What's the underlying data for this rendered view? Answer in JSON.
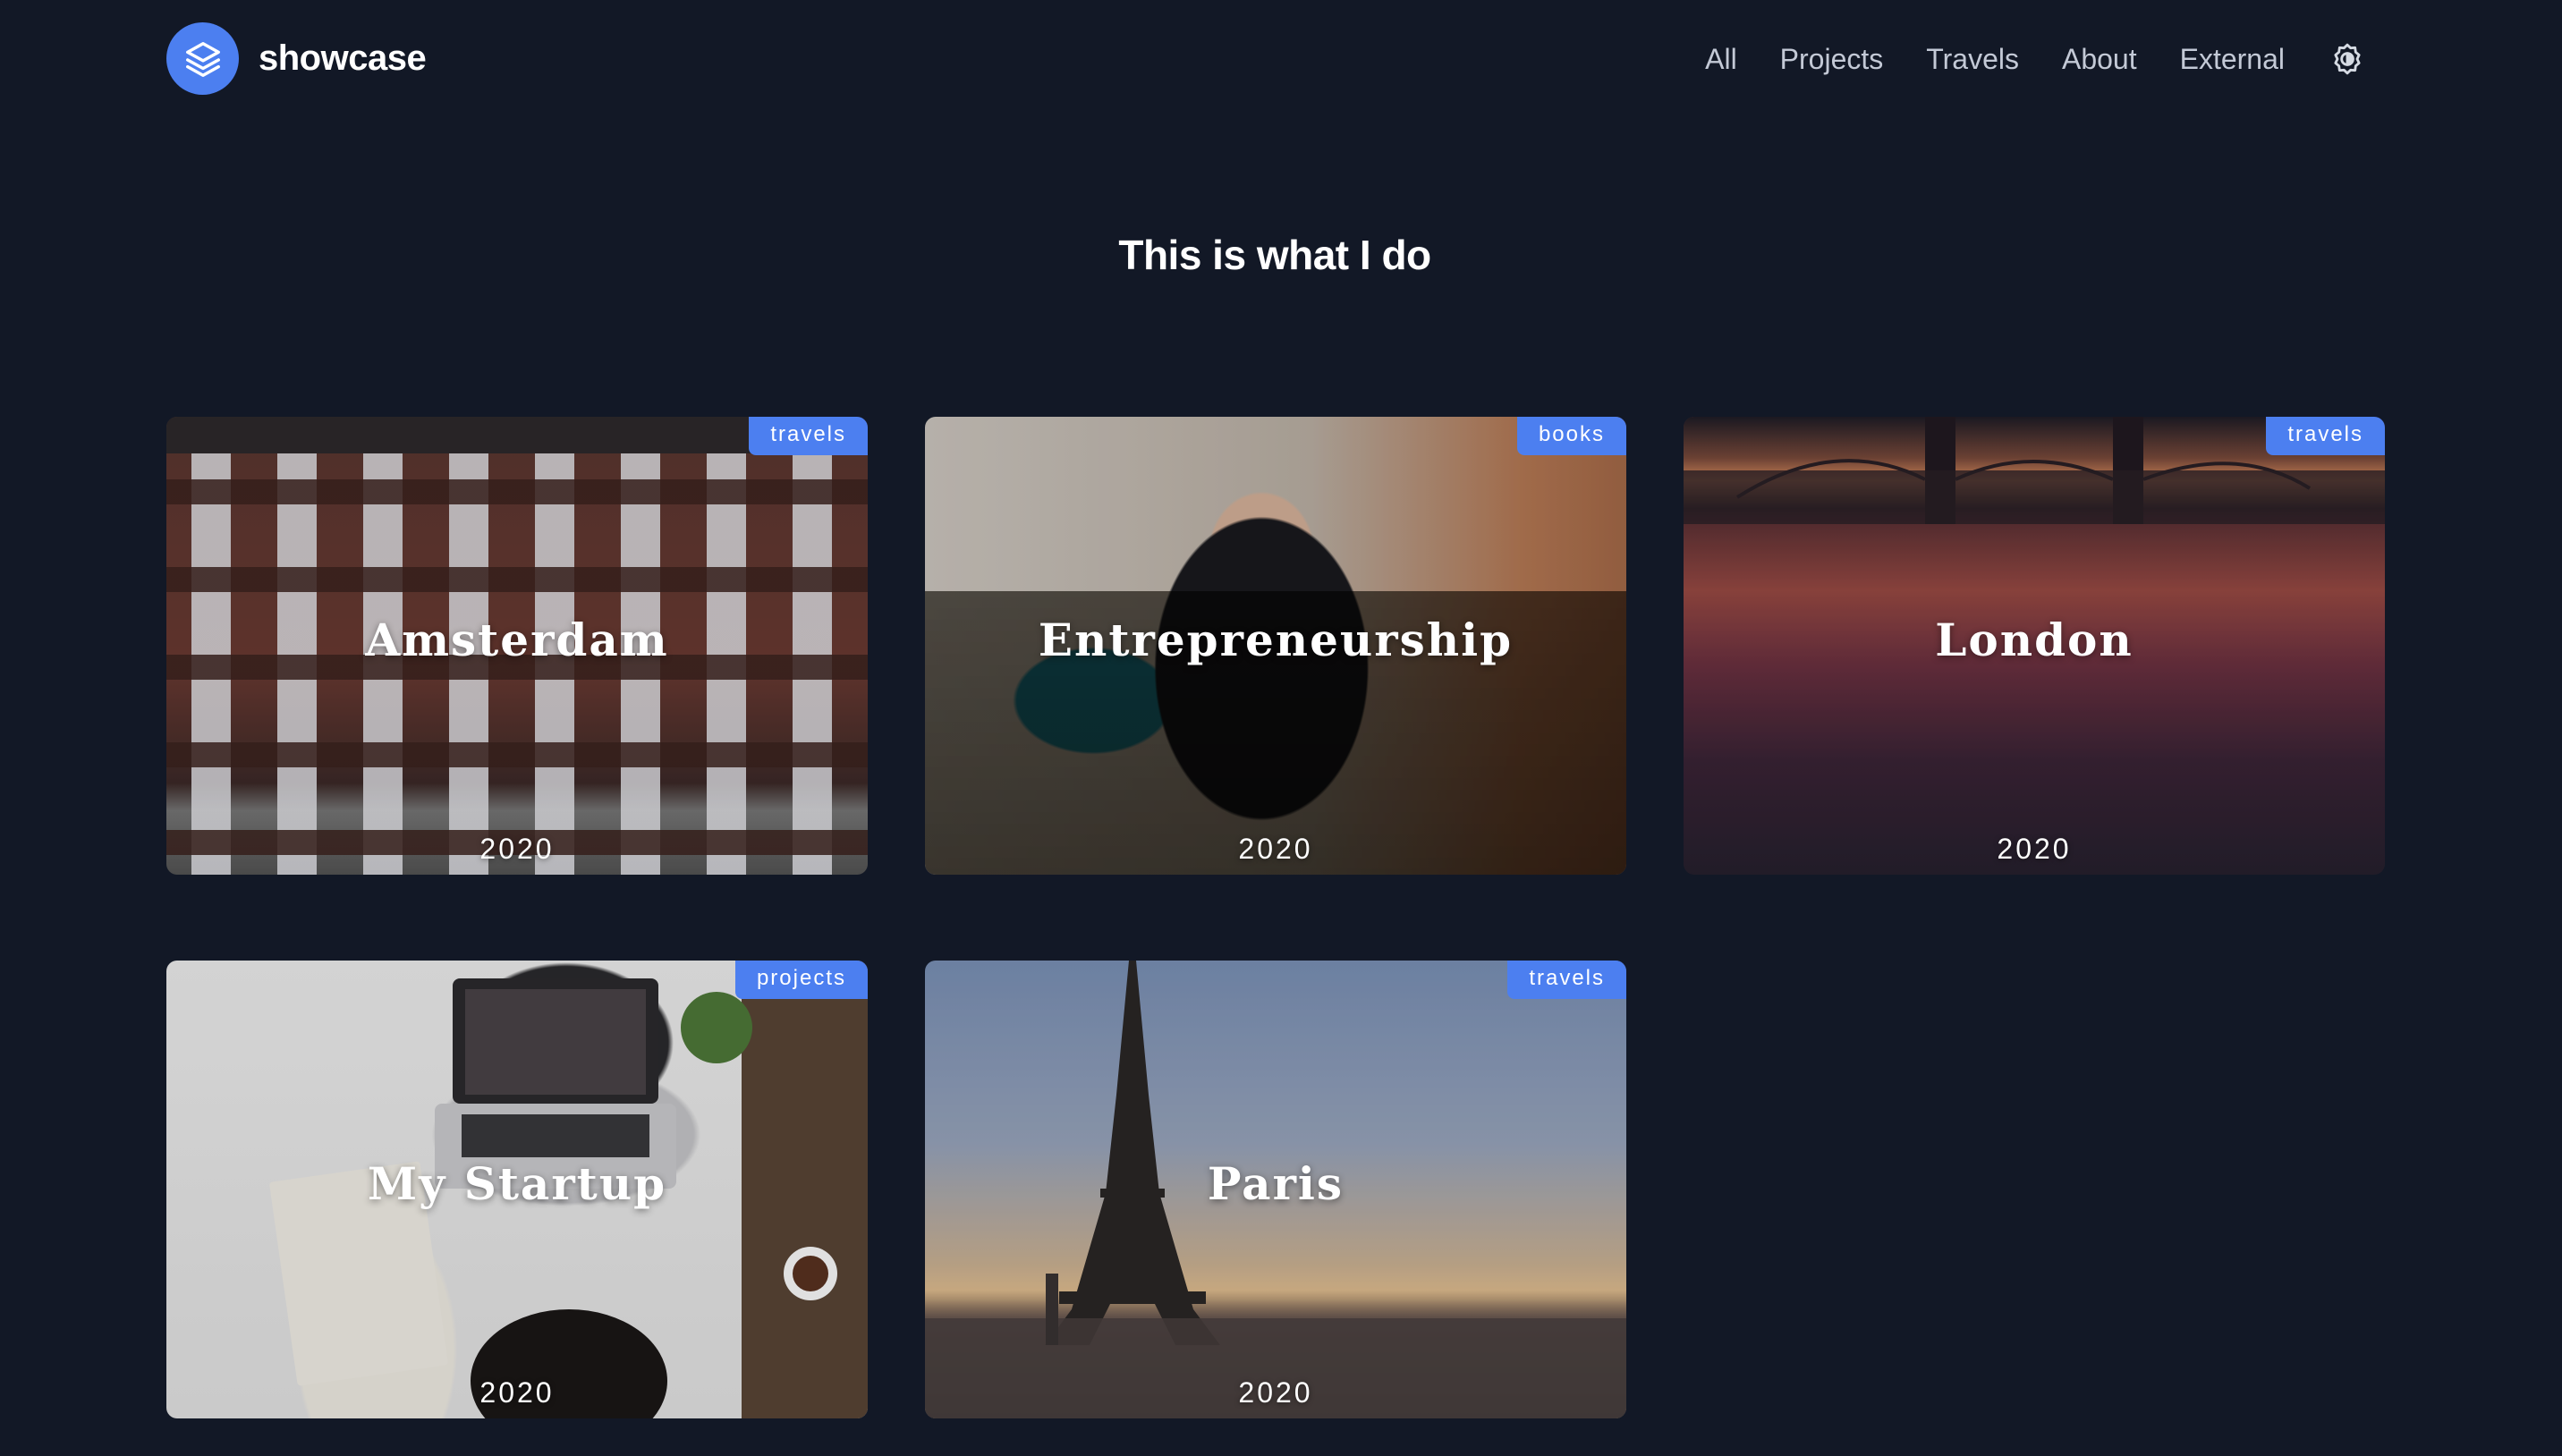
{
  "brand": {
    "name": "showcase",
    "logo_icon": "layers-icon",
    "accent": "#4c7ff0"
  },
  "nav": {
    "items": [
      "All",
      "Projects",
      "Travels",
      "About",
      "External"
    ],
    "theme_toggle_icon": "sun-settings-icon"
  },
  "page": {
    "title": "This is what I do",
    "background": "#121826"
  },
  "cards": [
    {
      "title": "Amsterdam",
      "tag": "travels",
      "year": "2020"
    },
    {
      "title": "Entrepreneurship",
      "tag": "books",
      "year": "2020"
    },
    {
      "title": "London",
      "tag": "travels",
      "year": "2020"
    },
    {
      "title": "My Startup",
      "tag": "projects",
      "year": "2020"
    },
    {
      "title": "Paris",
      "tag": "travels",
      "year": "2020"
    }
  ]
}
